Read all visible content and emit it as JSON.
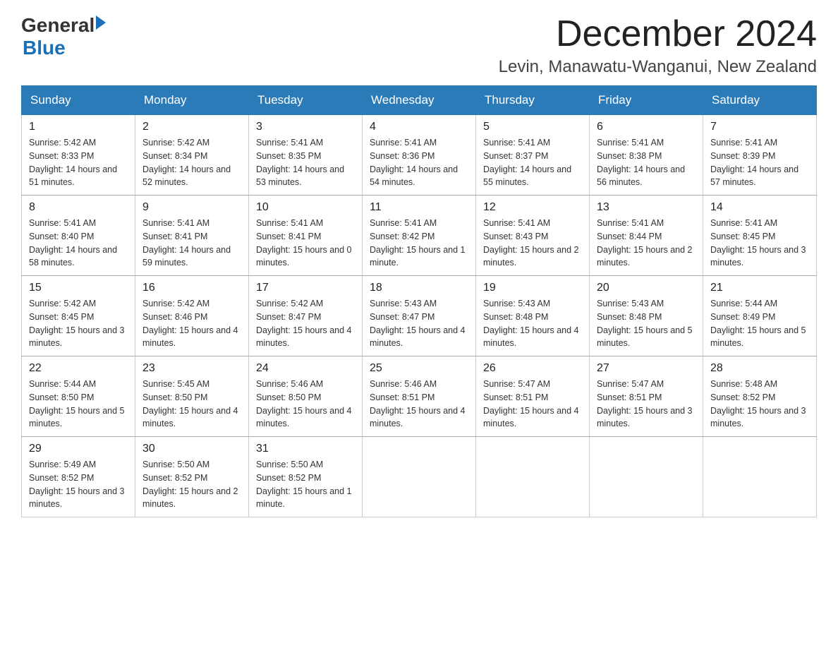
{
  "header": {
    "logo_general": "General",
    "logo_blue": "Blue",
    "month_title": "December 2024",
    "location": "Levin, Manawatu-Wanganui, New Zealand"
  },
  "weekdays": [
    "Sunday",
    "Monday",
    "Tuesday",
    "Wednesday",
    "Thursday",
    "Friday",
    "Saturday"
  ],
  "weeks": [
    [
      {
        "day": "1",
        "sunrise": "Sunrise: 5:42 AM",
        "sunset": "Sunset: 8:33 PM",
        "daylight": "Daylight: 14 hours and 51 minutes."
      },
      {
        "day": "2",
        "sunrise": "Sunrise: 5:42 AM",
        "sunset": "Sunset: 8:34 PM",
        "daylight": "Daylight: 14 hours and 52 minutes."
      },
      {
        "day": "3",
        "sunrise": "Sunrise: 5:41 AM",
        "sunset": "Sunset: 8:35 PM",
        "daylight": "Daylight: 14 hours and 53 minutes."
      },
      {
        "day": "4",
        "sunrise": "Sunrise: 5:41 AM",
        "sunset": "Sunset: 8:36 PM",
        "daylight": "Daylight: 14 hours and 54 minutes."
      },
      {
        "day": "5",
        "sunrise": "Sunrise: 5:41 AM",
        "sunset": "Sunset: 8:37 PM",
        "daylight": "Daylight: 14 hours and 55 minutes."
      },
      {
        "day": "6",
        "sunrise": "Sunrise: 5:41 AM",
        "sunset": "Sunset: 8:38 PM",
        "daylight": "Daylight: 14 hours and 56 minutes."
      },
      {
        "day": "7",
        "sunrise": "Sunrise: 5:41 AM",
        "sunset": "Sunset: 8:39 PM",
        "daylight": "Daylight: 14 hours and 57 minutes."
      }
    ],
    [
      {
        "day": "8",
        "sunrise": "Sunrise: 5:41 AM",
        "sunset": "Sunset: 8:40 PM",
        "daylight": "Daylight: 14 hours and 58 minutes."
      },
      {
        "day": "9",
        "sunrise": "Sunrise: 5:41 AM",
        "sunset": "Sunset: 8:41 PM",
        "daylight": "Daylight: 14 hours and 59 minutes."
      },
      {
        "day": "10",
        "sunrise": "Sunrise: 5:41 AM",
        "sunset": "Sunset: 8:41 PM",
        "daylight": "Daylight: 15 hours and 0 minutes."
      },
      {
        "day": "11",
        "sunrise": "Sunrise: 5:41 AM",
        "sunset": "Sunset: 8:42 PM",
        "daylight": "Daylight: 15 hours and 1 minute."
      },
      {
        "day": "12",
        "sunrise": "Sunrise: 5:41 AM",
        "sunset": "Sunset: 8:43 PM",
        "daylight": "Daylight: 15 hours and 2 minutes."
      },
      {
        "day": "13",
        "sunrise": "Sunrise: 5:41 AM",
        "sunset": "Sunset: 8:44 PM",
        "daylight": "Daylight: 15 hours and 2 minutes."
      },
      {
        "day": "14",
        "sunrise": "Sunrise: 5:41 AM",
        "sunset": "Sunset: 8:45 PM",
        "daylight": "Daylight: 15 hours and 3 minutes."
      }
    ],
    [
      {
        "day": "15",
        "sunrise": "Sunrise: 5:42 AM",
        "sunset": "Sunset: 8:45 PM",
        "daylight": "Daylight: 15 hours and 3 minutes."
      },
      {
        "day": "16",
        "sunrise": "Sunrise: 5:42 AM",
        "sunset": "Sunset: 8:46 PM",
        "daylight": "Daylight: 15 hours and 4 minutes."
      },
      {
        "day": "17",
        "sunrise": "Sunrise: 5:42 AM",
        "sunset": "Sunset: 8:47 PM",
        "daylight": "Daylight: 15 hours and 4 minutes."
      },
      {
        "day": "18",
        "sunrise": "Sunrise: 5:43 AM",
        "sunset": "Sunset: 8:47 PM",
        "daylight": "Daylight: 15 hours and 4 minutes."
      },
      {
        "day": "19",
        "sunrise": "Sunrise: 5:43 AM",
        "sunset": "Sunset: 8:48 PM",
        "daylight": "Daylight: 15 hours and 4 minutes."
      },
      {
        "day": "20",
        "sunrise": "Sunrise: 5:43 AM",
        "sunset": "Sunset: 8:48 PM",
        "daylight": "Daylight: 15 hours and 5 minutes."
      },
      {
        "day": "21",
        "sunrise": "Sunrise: 5:44 AM",
        "sunset": "Sunset: 8:49 PM",
        "daylight": "Daylight: 15 hours and 5 minutes."
      }
    ],
    [
      {
        "day": "22",
        "sunrise": "Sunrise: 5:44 AM",
        "sunset": "Sunset: 8:50 PM",
        "daylight": "Daylight: 15 hours and 5 minutes."
      },
      {
        "day": "23",
        "sunrise": "Sunrise: 5:45 AM",
        "sunset": "Sunset: 8:50 PM",
        "daylight": "Daylight: 15 hours and 4 minutes."
      },
      {
        "day": "24",
        "sunrise": "Sunrise: 5:46 AM",
        "sunset": "Sunset: 8:50 PM",
        "daylight": "Daylight: 15 hours and 4 minutes."
      },
      {
        "day": "25",
        "sunrise": "Sunrise: 5:46 AM",
        "sunset": "Sunset: 8:51 PM",
        "daylight": "Daylight: 15 hours and 4 minutes."
      },
      {
        "day": "26",
        "sunrise": "Sunrise: 5:47 AM",
        "sunset": "Sunset: 8:51 PM",
        "daylight": "Daylight: 15 hours and 4 minutes."
      },
      {
        "day": "27",
        "sunrise": "Sunrise: 5:47 AM",
        "sunset": "Sunset: 8:51 PM",
        "daylight": "Daylight: 15 hours and 3 minutes."
      },
      {
        "day": "28",
        "sunrise": "Sunrise: 5:48 AM",
        "sunset": "Sunset: 8:52 PM",
        "daylight": "Daylight: 15 hours and 3 minutes."
      }
    ],
    [
      {
        "day": "29",
        "sunrise": "Sunrise: 5:49 AM",
        "sunset": "Sunset: 8:52 PM",
        "daylight": "Daylight: 15 hours and 3 minutes."
      },
      {
        "day": "30",
        "sunrise": "Sunrise: 5:50 AM",
        "sunset": "Sunset: 8:52 PM",
        "daylight": "Daylight: 15 hours and 2 minutes."
      },
      {
        "day": "31",
        "sunrise": "Sunrise: 5:50 AM",
        "sunset": "Sunset: 8:52 PM",
        "daylight": "Daylight: 15 hours and 1 minute."
      },
      null,
      null,
      null,
      null
    ]
  ]
}
